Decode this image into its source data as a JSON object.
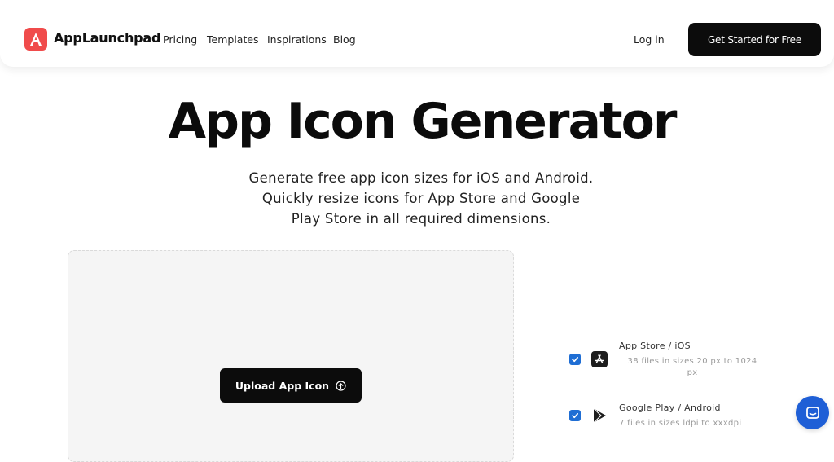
{
  "header": {
    "brand": "AppLaunchpad",
    "logo_letter": "A",
    "nav": [
      "Pricing",
      "Templates",
      "Inspirations",
      "Blog"
    ],
    "login_label": "Log in",
    "cta_label": "Get Started for Free"
  },
  "hero": {
    "title": "App Icon Generator",
    "subtitle_lines": [
      "Generate free app icon sizes for iOS and Android.",
      "Quickly resize icons for App Store and Google",
      "Play Store in all required dimensions."
    ]
  },
  "upload": {
    "button_label": "Upload App Icon"
  },
  "options": [
    {
      "title": "App Store / iOS",
      "description_lines": [
        "38 files in sizes 20 px to 1024",
        "px"
      ],
      "checked": true,
      "icon": "app-store-icon"
    },
    {
      "title": "Google Play / Android",
      "description_lines": [
        "7 files in sizes ldpi to xxxdpi"
      ],
      "checked": true,
      "icon": "google-play-icon"
    }
  ],
  "colors": {
    "brand_red": "#f04b4b",
    "checkbox_blue": "#1f6ed4",
    "chat_blue": "#1f5fd6",
    "button_black": "#0c0c0c"
  }
}
